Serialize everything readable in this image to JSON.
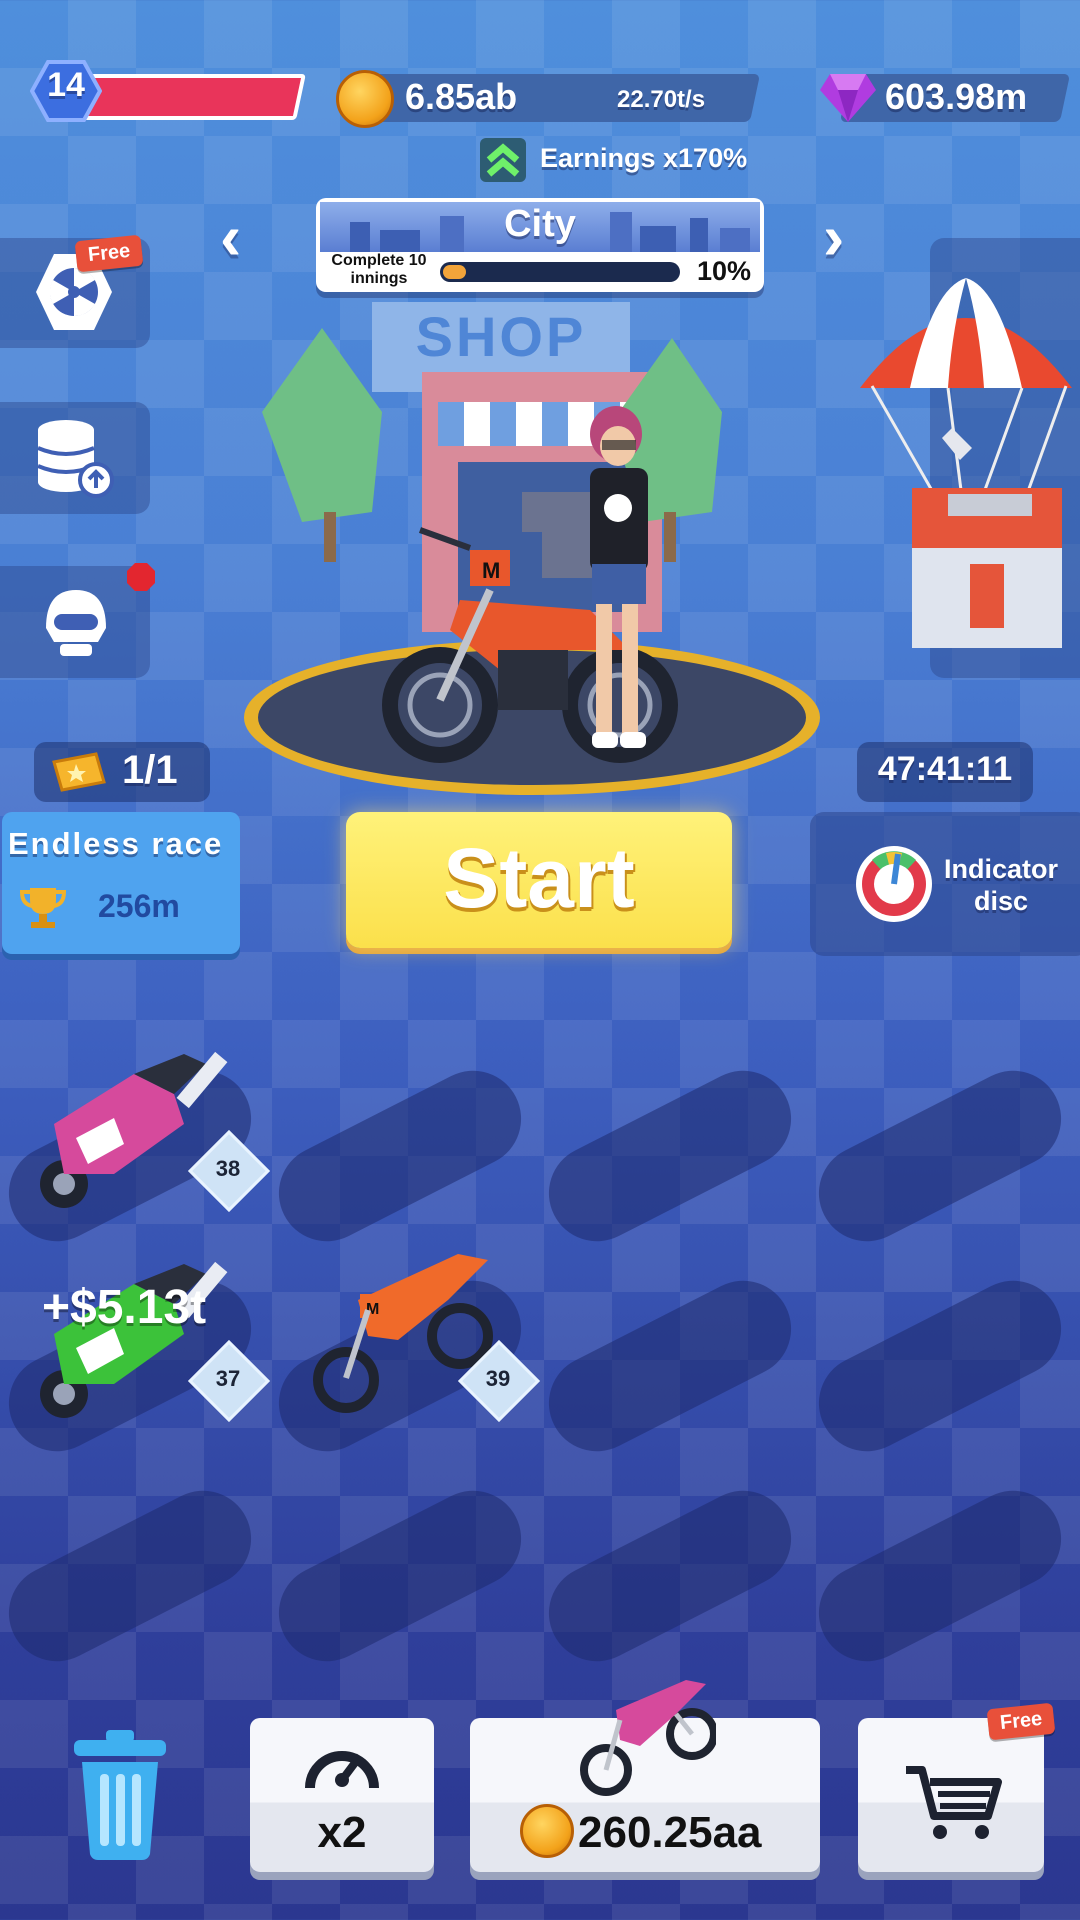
{
  "header": {
    "level": "14",
    "level_progress": 0.98,
    "coins": "6.85ab",
    "coin_rate": "22.70t/s",
    "gems": "603.98m",
    "earnings_boost": "Earnings x170%"
  },
  "stage": {
    "title": "City",
    "task": "Complete 10 innings",
    "progress_label": "10%",
    "progress": 0.1
  },
  "side_buttons": {
    "wheel_badge": "Free"
  },
  "scene": {
    "shop_sign": "SHOP"
  },
  "race": {
    "tickets": "1/1",
    "endless_title": "Endless race",
    "endless_best": "256m",
    "timer": "47:41:11",
    "indicator_label": "Indicator disc"
  },
  "start": {
    "label": "Start"
  },
  "garage": {
    "floating_income": "+$5.13t",
    "bike_levels": [
      "38",
      "37",
      "39"
    ]
  },
  "bottom": {
    "speed_label": "x2",
    "buy_price": "260.25aa",
    "shop_badge": "Free"
  },
  "colors": {
    "accent_yellow": "#fbe04b",
    "level_bar": "#e9345a",
    "free_tag": "#e8503a"
  }
}
